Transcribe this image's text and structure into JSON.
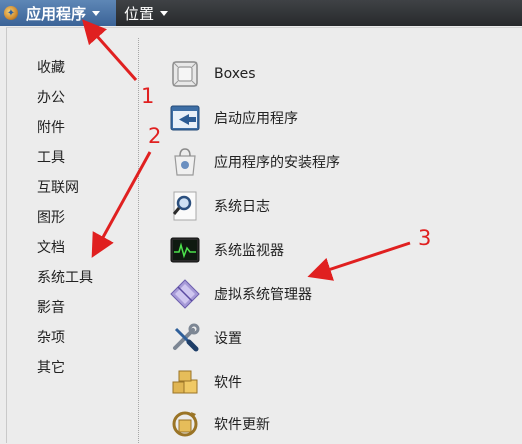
{
  "topbar": {
    "apps_menu_label": "应用程序",
    "places_menu_label": "位置"
  },
  "categories": [
    "收藏",
    "办公",
    "附件",
    "工具",
    "互联网",
    "图形",
    "文档",
    "系统工具",
    "影音",
    "杂项",
    "其它"
  ],
  "applications": [
    {
      "name": "Boxes",
      "icon": "boxes-icon"
    },
    {
      "name": "启动应用程序",
      "icon": "startup-apps-icon"
    },
    {
      "name": "应用程序的安装程序",
      "icon": "app-installer-icon"
    },
    {
      "name": "系统日志",
      "icon": "system-log-icon"
    },
    {
      "name": "系统监视器",
      "icon": "system-monitor-icon"
    },
    {
      "name": "虚拟系统管理器",
      "icon": "virt-manager-icon"
    },
    {
      "name": "设置",
      "icon": "settings-icon"
    },
    {
      "name": "软件",
      "icon": "software-icon"
    },
    {
      "name": "软件更新",
      "icon": "software-update-icon"
    }
  ],
  "annotations": [
    "1",
    "2",
    "3"
  ],
  "colors": {
    "panel": "#2f3135",
    "active_menu": "#4a74a8",
    "menu_bg": "#ececec",
    "annotation": "#e02020"
  }
}
